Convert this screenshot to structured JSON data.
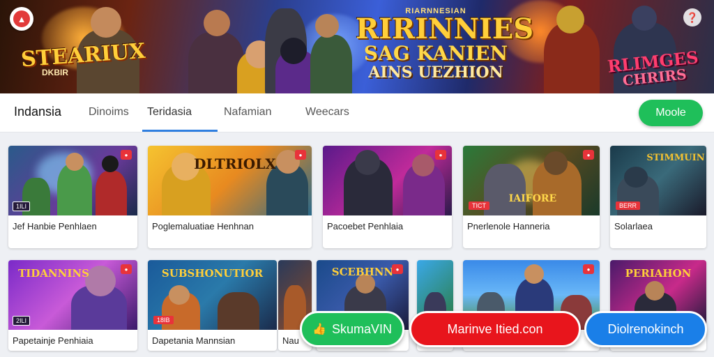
{
  "hero": {
    "logo_icon": "app-logo-icon",
    "help_icon": "help-icon",
    "title_small": "RIARNNESIAN",
    "title_line1": "RIRINNIES",
    "title_line2": "SAG KANIEN",
    "title_line3": "AINS UEZHION",
    "left_title": "STEARIUX",
    "left_subtitle": "DKBIR",
    "right_title1": "RLIMGES",
    "right_title2": "CHRIRS"
  },
  "nav": {
    "brand": "Indansia",
    "tabs": [
      "Dinoims",
      "Teridasia",
      "Nafamian",
      "Weecars"
    ],
    "active_tab_index": 1,
    "cta_label": "Moole"
  },
  "cards": [
    {
      "caption": "Jef Hanbie Penhlaen",
      "thumb_title": "",
      "tag": "1ILI"
    },
    {
      "caption": "Poglemaluatiae Henhnan",
      "thumb_title": "DLTRIOLX",
      "tag": ""
    },
    {
      "caption": "Pacoebet Penhlaia",
      "thumb_title": "",
      "tag": ""
    },
    {
      "caption": "Pnerlenole Hanneria",
      "thumb_title": "",
      "tag": "TICT"
    },
    {
      "caption": "Solarlaea",
      "thumb_title": "STIMMUIN",
      "tag": ""
    },
    {
      "caption": "Papetainje Penhiaia",
      "thumb_title": "TIDANNINS",
      "tag": ""
    },
    {
      "caption": "Dapetania Mannsian",
      "thumb_title": "SUBSHONUTIOR",
      "tag": "18IB"
    },
    {
      "caption": "Nau",
      "thumb_title": "",
      "tag": ""
    },
    {
      "caption": "",
      "thumb_title": "SCEBHNN",
      "tag": ""
    },
    {
      "caption": "",
      "thumb_title": "",
      "tag": ""
    },
    {
      "caption": "",
      "thumb_title": "",
      "tag": ""
    },
    {
      "caption": "",
      "thumb_title": "PERIAHON",
      "tag": ""
    }
  ],
  "buttons": {
    "green_label": "SkumaVIN",
    "green_icon": "thumbs-up-icon",
    "red_label": "Marinve Itied.con",
    "blue_label": "Diolrenokinch"
  }
}
